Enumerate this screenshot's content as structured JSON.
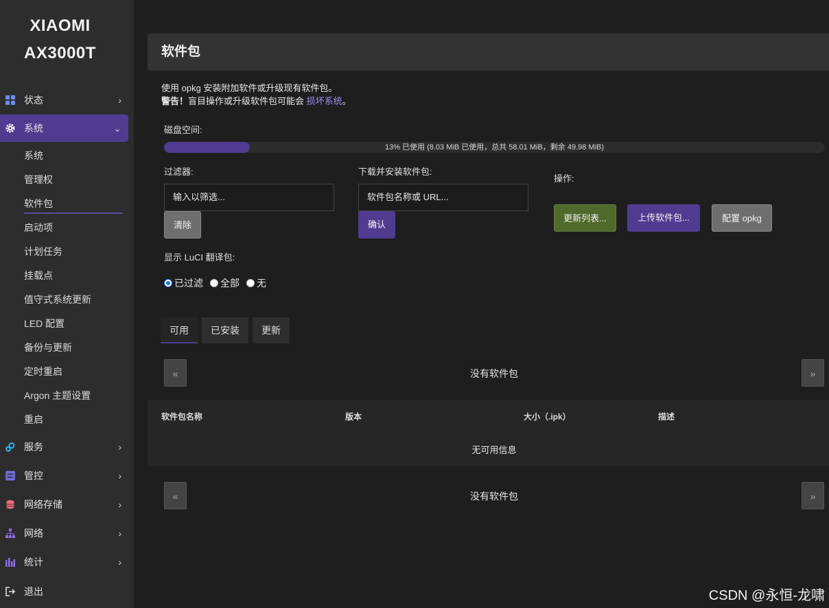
{
  "brand": {
    "line1": "XIAOMI",
    "line2": "AX3000T"
  },
  "sidebar": {
    "sections": [
      {
        "label": "状态",
        "icon": "dashboard-icon",
        "chevron": "›"
      },
      {
        "label": "系统",
        "icon": "gear-icon",
        "chevron": "⌄"
      },
      {
        "label": "服务",
        "icon": "cogs-icon",
        "chevron": "›"
      },
      {
        "label": "管控",
        "icon": "sliders-icon",
        "chevron": "›"
      },
      {
        "label": "网络存储",
        "icon": "database-icon",
        "chevron": "›"
      },
      {
        "label": "网络",
        "icon": "sitemap-icon",
        "chevron": "›"
      },
      {
        "label": "统计",
        "icon": "bar-chart-icon",
        "chevron": "›"
      },
      {
        "label": "退出",
        "icon": "logout-icon"
      }
    ],
    "system_items": [
      "系统",
      "管理权",
      "软件包",
      "启动项",
      "计划任务",
      "挂载点",
      "值守式系统更新",
      "LED 配置",
      "备份与更新",
      "定时重启",
      "Argon 主题设置",
      "重启"
    ]
  },
  "page": {
    "title": "软件包",
    "desc_line1": "使用 opkg 安装附加软件或升级现有软件包。",
    "warning_prefix": "警告！",
    "warning_text": "盲目操作或升级软件包可能会",
    "warning_link": "损坏系统",
    "warning_end": "。"
  },
  "disk": {
    "label": "磁盘空间:",
    "used_fraction": 0.13,
    "text": "13% 已使用 (8.03 MiB 已使用，总共 58.01 MiB，剩余 49.98 MiB)"
  },
  "filter": {
    "label": "过滤器:",
    "placeholder": "输入以筛选...",
    "clear_label": "清除"
  },
  "download": {
    "label": "下载并安装软件包:",
    "placeholder": "软件包名称或 URL...",
    "confirm_label": "确认"
  },
  "actions": {
    "label": "操作:",
    "update_label": "更新列表...",
    "upload_label": "上传软件包...",
    "config_label": "配置 opkg"
  },
  "luci": {
    "label": "显示 LuCI 翻译包:",
    "options": [
      "已过滤",
      "全部",
      "无"
    ],
    "selected": "已过滤"
  },
  "tabs": [
    "可用",
    "已安装",
    "更新"
  ],
  "pager": {
    "prev": "«",
    "next": "»",
    "empty": "没有软件包"
  },
  "table": {
    "headers": [
      "软件包名称",
      "版本",
      "大小（.ipk）",
      "描述"
    ],
    "empty": "无可用信息"
  },
  "watermark": "CSDN @永恒-龙啸"
}
